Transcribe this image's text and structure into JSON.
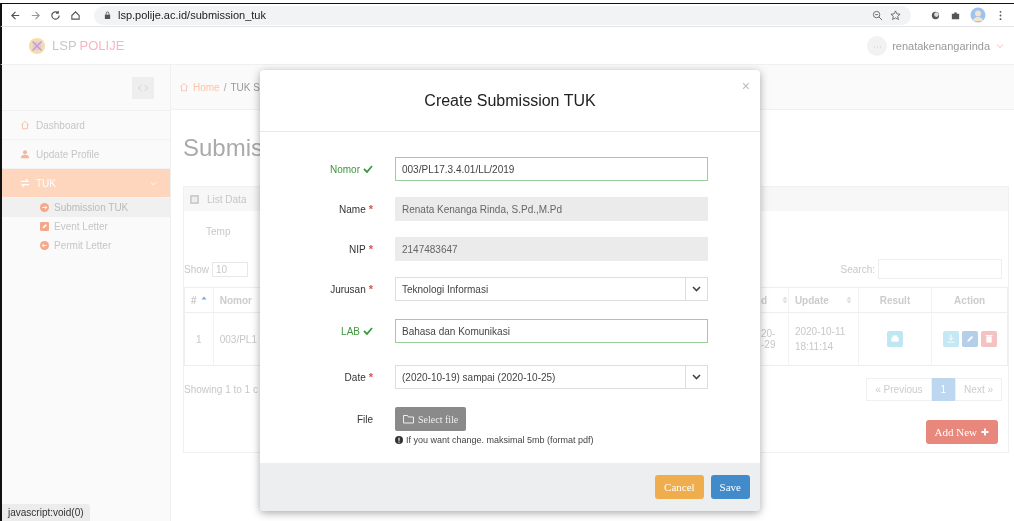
{
  "browser": {
    "url": "lsp.polije.ac.id/submission_tuk"
  },
  "app": {
    "logo": [
      "LSP",
      "POLIJE"
    ],
    "user": "renatakenangarinda"
  },
  "sidebar": {
    "items": [
      {
        "label": "Dashboard",
        "selected": false
      },
      {
        "label": "Update Profile",
        "selected": false
      },
      {
        "label": "TUK",
        "selected": true,
        "expanded": true,
        "children": [
          {
            "label": "Submission TUK",
            "selected": true
          },
          {
            "label": "Event Letter",
            "selected": false
          },
          {
            "label": "Permit Letter",
            "selected": false
          }
        ]
      }
    ]
  },
  "breadcrumb": [
    "Home",
    "/",
    "TUK S"
  ],
  "page_title": "Submis",
  "card": {
    "title": "List Data",
    "filter_label": "Temp",
    "show_label": "Show",
    "show_value": "10",
    "search_label": "Search:",
    "columns": [
      {
        "label": "#",
        "sortable": true,
        "sorted": true
      },
      {
        "label": "Nomor"
      },
      {
        "label": "d",
        "sortable": true,
        "sorted": false
      },
      {
        "label": "Update",
        "sortable": true,
        "sorted": false
      },
      {
        "label": "Result"
      },
      {
        "label": "Action"
      }
    ],
    "rows": [
      {
        "index": "1",
        "nomor": "003/PL1",
        "column_3": [
          "20-",
          "-29"
        ],
        "update": "2020-10-11 18:11:14"
      }
    ],
    "info": "Showing 1 to 1 c",
    "pagination": {
      "previous": "« Previous",
      "pages": [
        {
          "label": "1",
          "selected": true
        }
      ],
      "next": "Next »"
    },
    "add_button": "Add New"
  },
  "modal": {
    "title": "Create Submission TUK",
    "close": "×",
    "fields": [
      {
        "label": "Nomor",
        "kind": "text",
        "valid": true,
        "value": "003/PL17.3.4.01/LL/2019"
      },
      {
        "label": "Name",
        "kind": "disabled",
        "required_mark": "*",
        "valid": false,
        "value": "Renata Kenanga Rinda, S.Pd.,M.Pd"
      },
      {
        "label": "NIP",
        "kind": "disabled",
        "required_mark": "*",
        "valid": false,
        "value": "2147483647"
      },
      {
        "label": "Jurusan",
        "kind": "select",
        "required_mark": "*",
        "valid": false,
        "value": "Teknologi Informasi"
      },
      {
        "label": "LAB",
        "kind": "text",
        "valid": true,
        "value": "Bahasa dan Komunikasi"
      },
      {
        "label": "Date",
        "kind": "select",
        "required_mark": "*",
        "valid": false,
        "value": "(2020-10-19) sampai (2020-10-25)"
      },
      {
        "label": "File",
        "kind": "file",
        "valid": false,
        "button": "Select file",
        "help": "If you want change. maksimal 5mb (format pdf)"
      }
    ],
    "buttons": [
      {
        "label": "Cancel",
        "kind": "cancel"
      },
      {
        "label": "Save",
        "kind": "save"
      }
    ]
  },
  "status_bar": "javascript:void(0)"
}
